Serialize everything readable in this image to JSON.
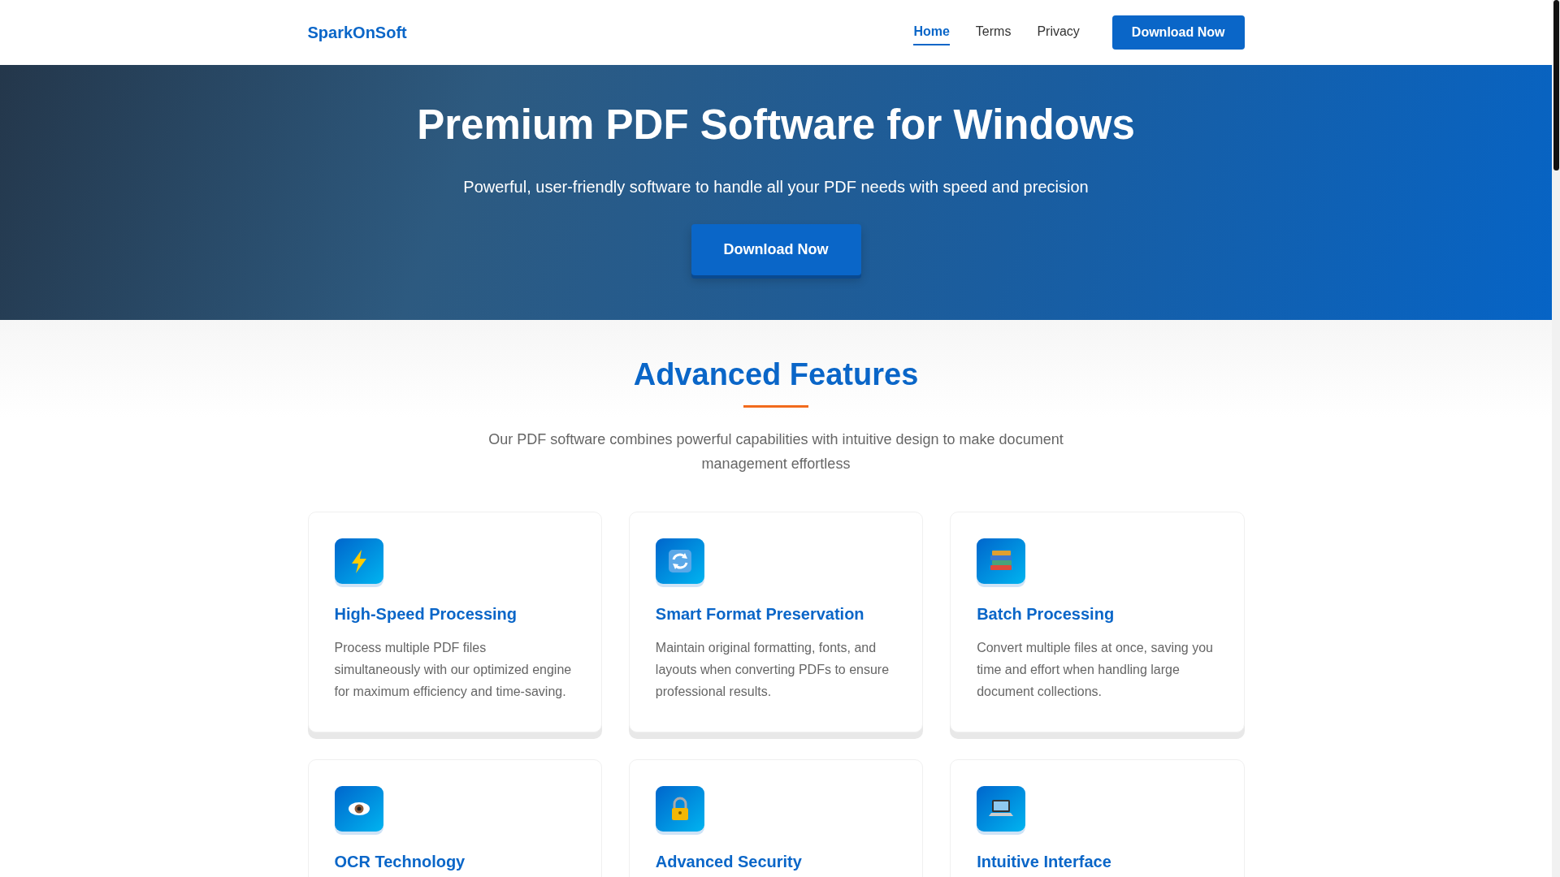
{
  "header": {
    "logo": "SparkOnSoft",
    "nav": [
      {
        "label": "Home",
        "selected": true
      },
      {
        "label": "Terms",
        "selected": false
      },
      {
        "label": "Privacy",
        "selected": false
      }
    ],
    "cta": "Download Now"
  },
  "hero": {
    "title": "Premium PDF Software for Windows",
    "subtitle": "Powerful, user-friendly software to handle all your PDF needs with speed and precision",
    "button": "Download Now"
  },
  "features": {
    "title": "Advanced Features",
    "intro": "Our PDF software combines powerful capabilities with intuitive design to make document management effortless",
    "cards": [
      {
        "title": "High-Speed Processing",
        "text": "Process multiple PDF files simultaneously with our optimized engine for maximum efficiency and time-saving."
      },
      {
        "title": "Smart Format Preservation",
        "text": "Maintain original formatting, fonts, and layouts when converting PDFs to ensure professional results."
      },
      {
        "title": "Batch Processing",
        "text": "Convert multiple files at once, saving you time and effort when handling large document collections."
      },
      {
        "title": "OCR Technology"
      },
      {
        "title": "Advanced Security"
      },
      {
        "title": "Intuitive Interface"
      }
    ]
  }
}
